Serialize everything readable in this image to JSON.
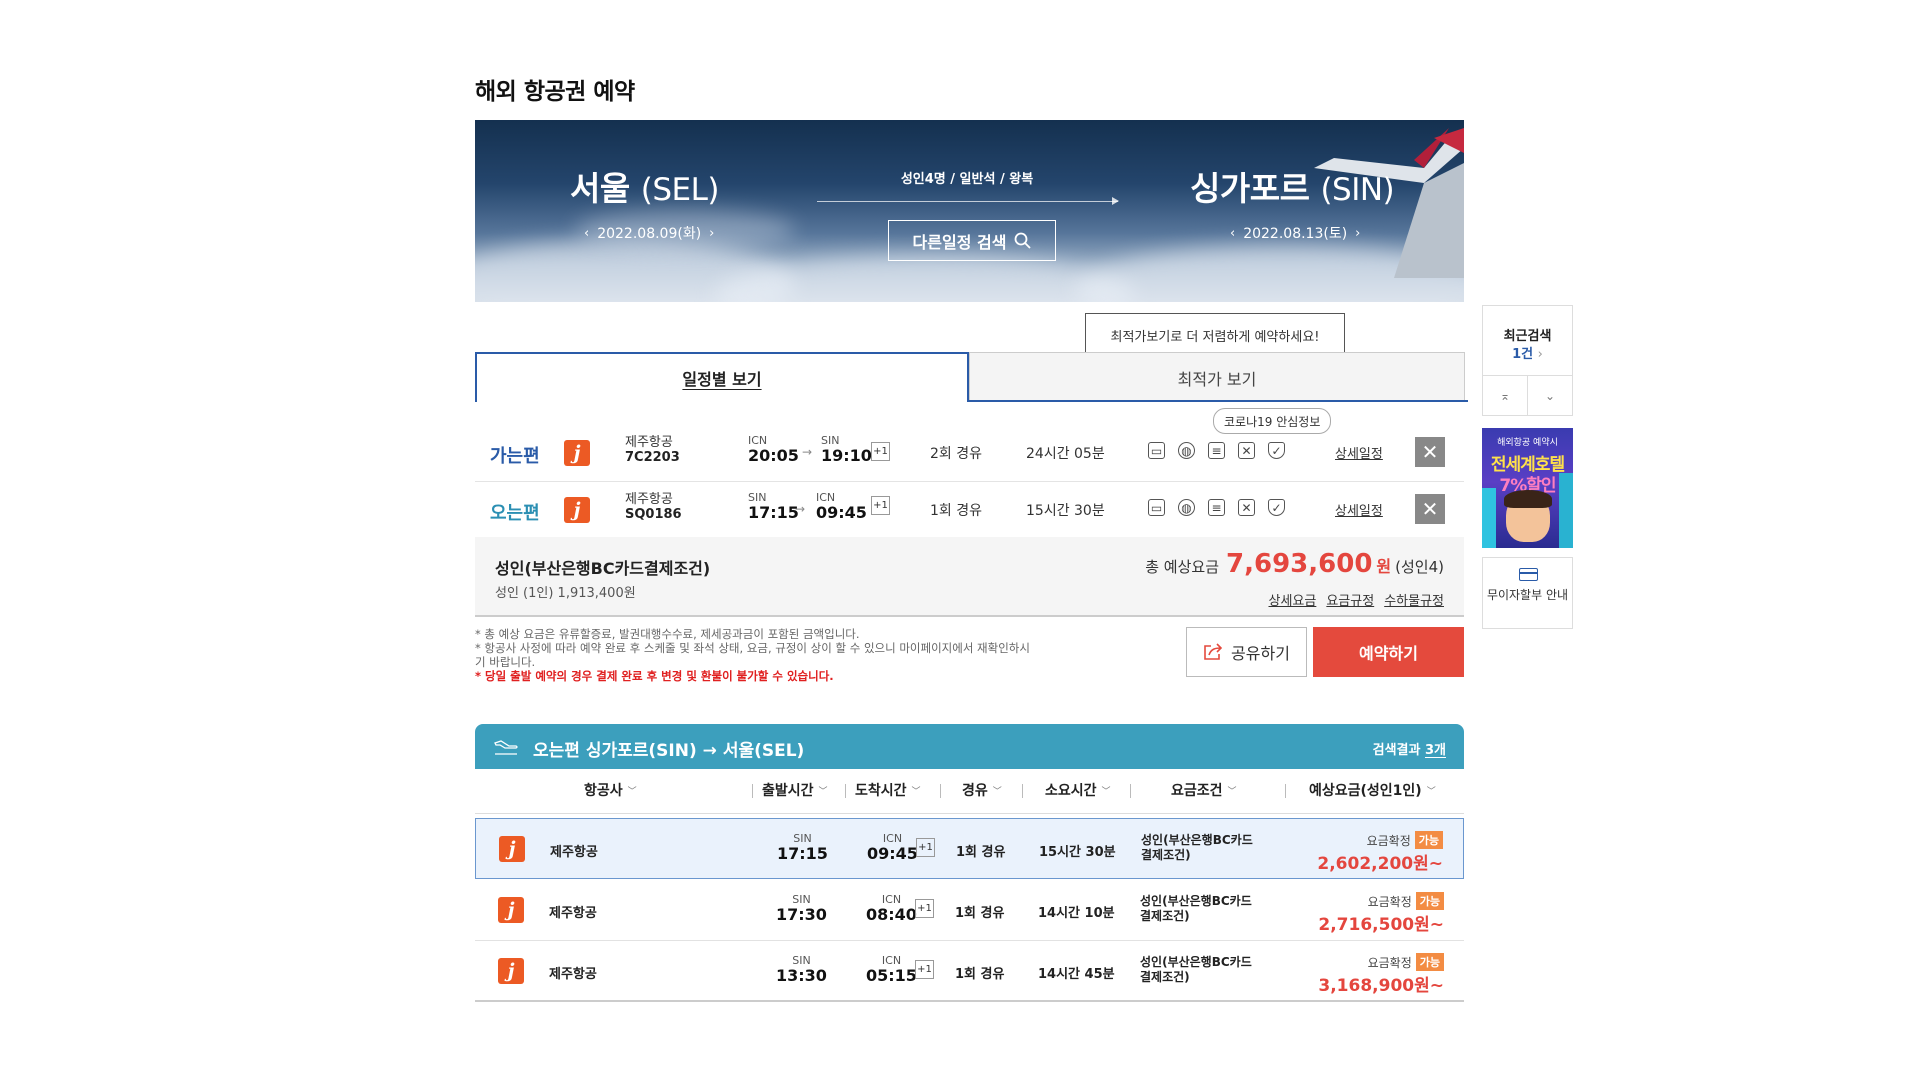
{
  "page_title": "해외 항공권 예약",
  "hero": {
    "origin_city": "서울",
    "origin_code": "(SEL)",
    "origin_date": "2022.08.09(화)",
    "dest_city": "싱가포르",
    "dest_code": "(SIN)",
    "dest_date": "2022.08.13(토)",
    "pax_info": "성인4명 / 일반석 / 왕복",
    "search_button": "다른일정 검색"
  },
  "tabs": {
    "tooltip": "최적가보기로 더 저렴하게 예약하세요!",
    "schedule": "일정별 보기",
    "price": "최적가 보기"
  },
  "covid_tip": "코로나19 안심정보",
  "itinerary": [
    {
      "direction": "가는편",
      "airline": "제주항공",
      "flight_no": "7C2203",
      "dep_airport": "ICN",
      "dep_time": "20:05",
      "arr_airport": "SIN",
      "arr_time": "19:10",
      "plus_day": "+1",
      "stops": "2회 경유",
      "duration": "24시간 05분",
      "detail": "상세일정"
    },
    {
      "direction": "오는편",
      "airline": "제주항공",
      "flight_no": "SQ0186",
      "dep_airport": "SIN",
      "dep_time": "17:15",
      "arr_airport": "ICN",
      "arr_time": "09:45",
      "plus_day": "+1",
      "stops": "1회 경유",
      "duration": "15시간 30분",
      "detail": "상세일정"
    }
  ],
  "fare": {
    "condition": "성인(부산은행BC카드결제조건)",
    "per_person": "성인 (1인)  1,913,400원",
    "total_label": "총 예상요금",
    "total_amount": "7,693,600",
    "currency": "원",
    "pax": "(성인4)",
    "links": [
      "상세요금",
      "요금규정",
      "수하물규정"
    ]
  },
  "notes": {
    "line1": "* 총 예상 요금은 유류할증료, 발권대행수수료, 제세공과금이 포함된 금액입니다.",
    "line2": "* 항공사 사정에 따라 예약 완료 후 스케줄 및 좌석 상태, 요금, 규정이 상이 할 수 있으니 마이페이지에서 재확인하시기 바랍니다.",
    "warning": "* 당일 출발 예약의 경우 결제 완료 후 변경 및 환불이 불가할 수 있습니다."
  },
  "actions": {
    "share": "공유하기",
    "book": "예약하기"
  },
  "results": {
    "title": "오는편  싱가포르(SIN) → 서울(SEL)",
    "count_label": "검색결과",
    "count": "3개",
    "columns": [
      "항공사",
      "출발시간",
      "도착시간",
      "경유",
      "소요시간",
      "요금조건",
      "예상요금(성인1인)"
    ],
    "rows": [
      {
        "airline": "제주항공",
        "dep_airport": "SIN",
        "dep_time": "17:15",
        "arr_airport": "ICN",
        "arr_time": "09:45",
        "plus_day": "+1",
        "stops": "1회 경유",
        "duration": "15시간 30분",
        "condition": "성인(부산은행BC카드결제조건)",
        "price_label": "요금확정",
        "badge": "가능",
        "price": "2,602,200원~",
        "selected": true
      },
      {
        "airline": "제주항공",
        "dep_airport": "SIN",
        "dep_time": "17:30",
        "arr_airport": "ICN",
        "arr_time": "08:40",
        "plus_day": "+1",
        "stops": "1회 경유",
        "duration": "14시간 10분",
        "condition": "성인(부산은행BC카드결제조건)",
        "price_label": "요금확정",
        "badge": "가능",
        "price": "2,716,500원~",
        "selected": false
      },
      {
        "airline": "제주항공",
        "dep_airport": "SIN",
        "dep_time": "13:30",
        "arr_airport": "ICN",
        "arr_time": "05:15",
        "plus_day": "+1",
        "stops": "1회 경유",
        "duration": "14시간 45분",
        "condition": "성인(부산은행BC카드결제조건)",
        "price_label": "요금확정",
        "badge": "가능",
        "price": "3,168,900원~",
        "selected": false
      }
    ]
  },
  "sidebar": {
    "recent_title": "최근검색",
    "recent_count": "1건",
    "ad_line1": "해외항공 예약시",
    "ad_line2": "전세계호텔",
    "ad_line3": "7%할인",
    "installment": "무이자할부 안내"
  },
  "colors": {
    "primary_blue": "#2a5ba8",
    "teal": "#3c9fbd",
    "price_red": "#e4463e",
    "book_red": "#e44a3d",
    "badge_orange": "#f38c43",
    "airline_logo": "#ec5a24"
  }
}
